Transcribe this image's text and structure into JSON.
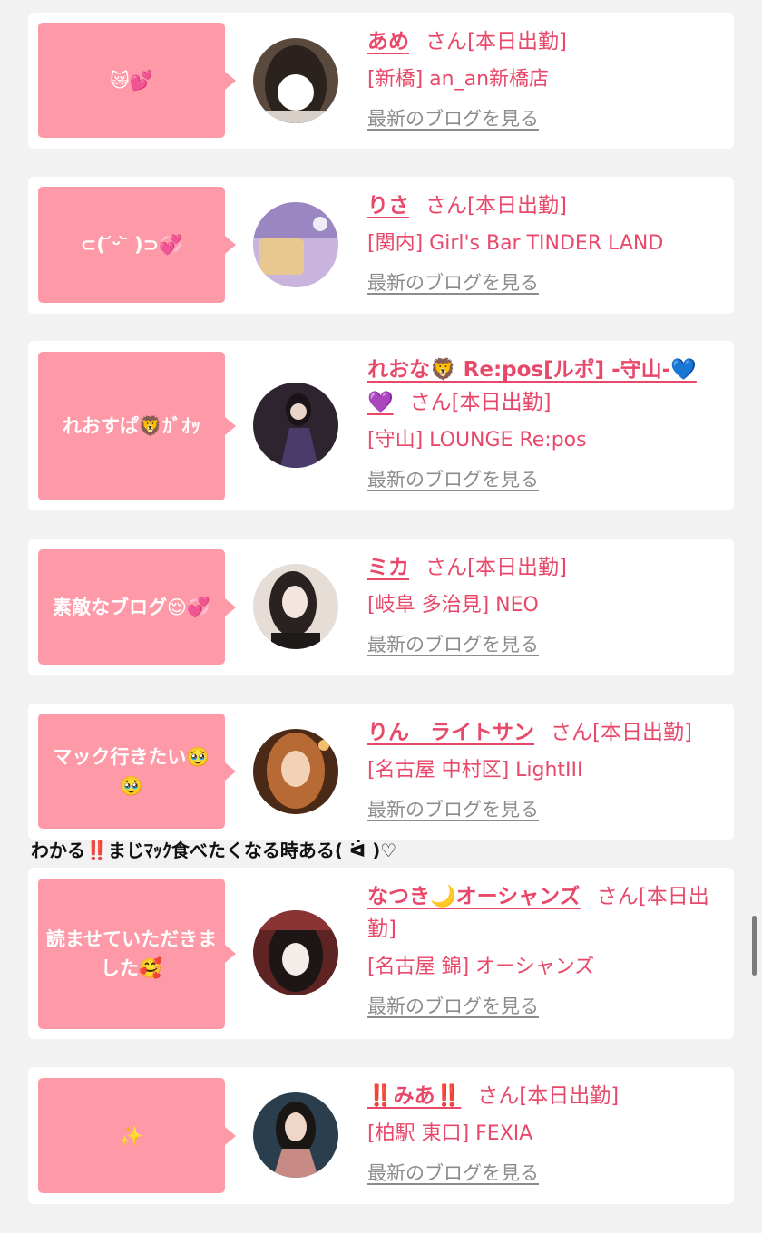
{
  "cards": [
    {
      "bubble": "😿💕",
      "name": "あめ",
      "san": "さん[本日出勤]",
      "shop": "[新橋] an_an新橋店",
      "blog_link": "最新のブログを見る",
      "avatar_colors": [
        "#3a2e28",
        "#e8e2dc"
      ]
    },
    {
      "bubble": "⊂( ᷄ᵕ ᷅ )⊃💞",
      "name": "りさ",
      "san": "さん[本日出勤]",
      "shop": "[関内] Girl's Bar TINDER LAND",
      "blog_link": "最新のブログを見る",
      "avatar_colors": [
        "#b59bd0",
        "#e9c89a"
      ]
    },
    {
      "bubble": "れおすぱ🦁ｶﾞｵｯ",
      "name_line1": "れおな🦁 Re:pos[ルポ] -守山-💙",
      "name_line2": "💜",
      "san": "さん[本日出勤]",
      "shop": "[守山] LOUNGE Re:pos",
      "blog_link": "最新のブログを見る",
      "avatar_colors": [
        "#3b2a3a",
        "#6e5a8a"
      ]
    },
    {
      "bubble": "素敵なブログ😌💞",
      "name": "ミカ",
      "san": "さん[本日出勤]",
      "shop": "[岐阜 多治見] NEO",
      "blog_link": "最新のブログを見る",
      "avatar_colors": [
        "#d9cdc4",
        "#2a2220"
      ]
    },
    {
      "bubble": "マック行きたい🥹🥹",
      "name": "りん　ライトサン",
      "san": "さん[本日出勤]",
      "shop": "[名古屋 中村区] LightIII",
      "blog_link": "最新のブログを見る",
      "avatar_colors": [
        "#6a3a1e",
        "#e8a86a"
      ]
    },
    {
      "bubble": "読ませていただきました🥰",
      "name": "なつき🌙オーシャンズ",
      "san": "さん[本日出勤]",
      "shop": "[名古屋 錦] オーシャンズ",
      "blog_link": "最新のブログを見る",
      "avatar_colors": [
        "#5a2a2a",
        "#f0e8e6"
      ]
    },
    {
      "bubble": "✨",
      "name": "‼️みあ‼️",
      "san": "さん[本日出勤]",
      "shop": "[柏駅 東口] FEXIA",
      "blog_link": "最新のブログを見る",
      "avatar_colors": [
        "#2e3a44",
        "#d8a090"
      ]
    }
  ],
  "comment": "わかる‼️まじﾏｯｸ食べたくなる時ある( ᐛ )♡",
  "colors": {
    "accent": "#e8496a",
    "bubble": "#fe9aa8",
    "link_gray": "#8c8c8c",
    "background": "#f2f2f2"
  }
}
